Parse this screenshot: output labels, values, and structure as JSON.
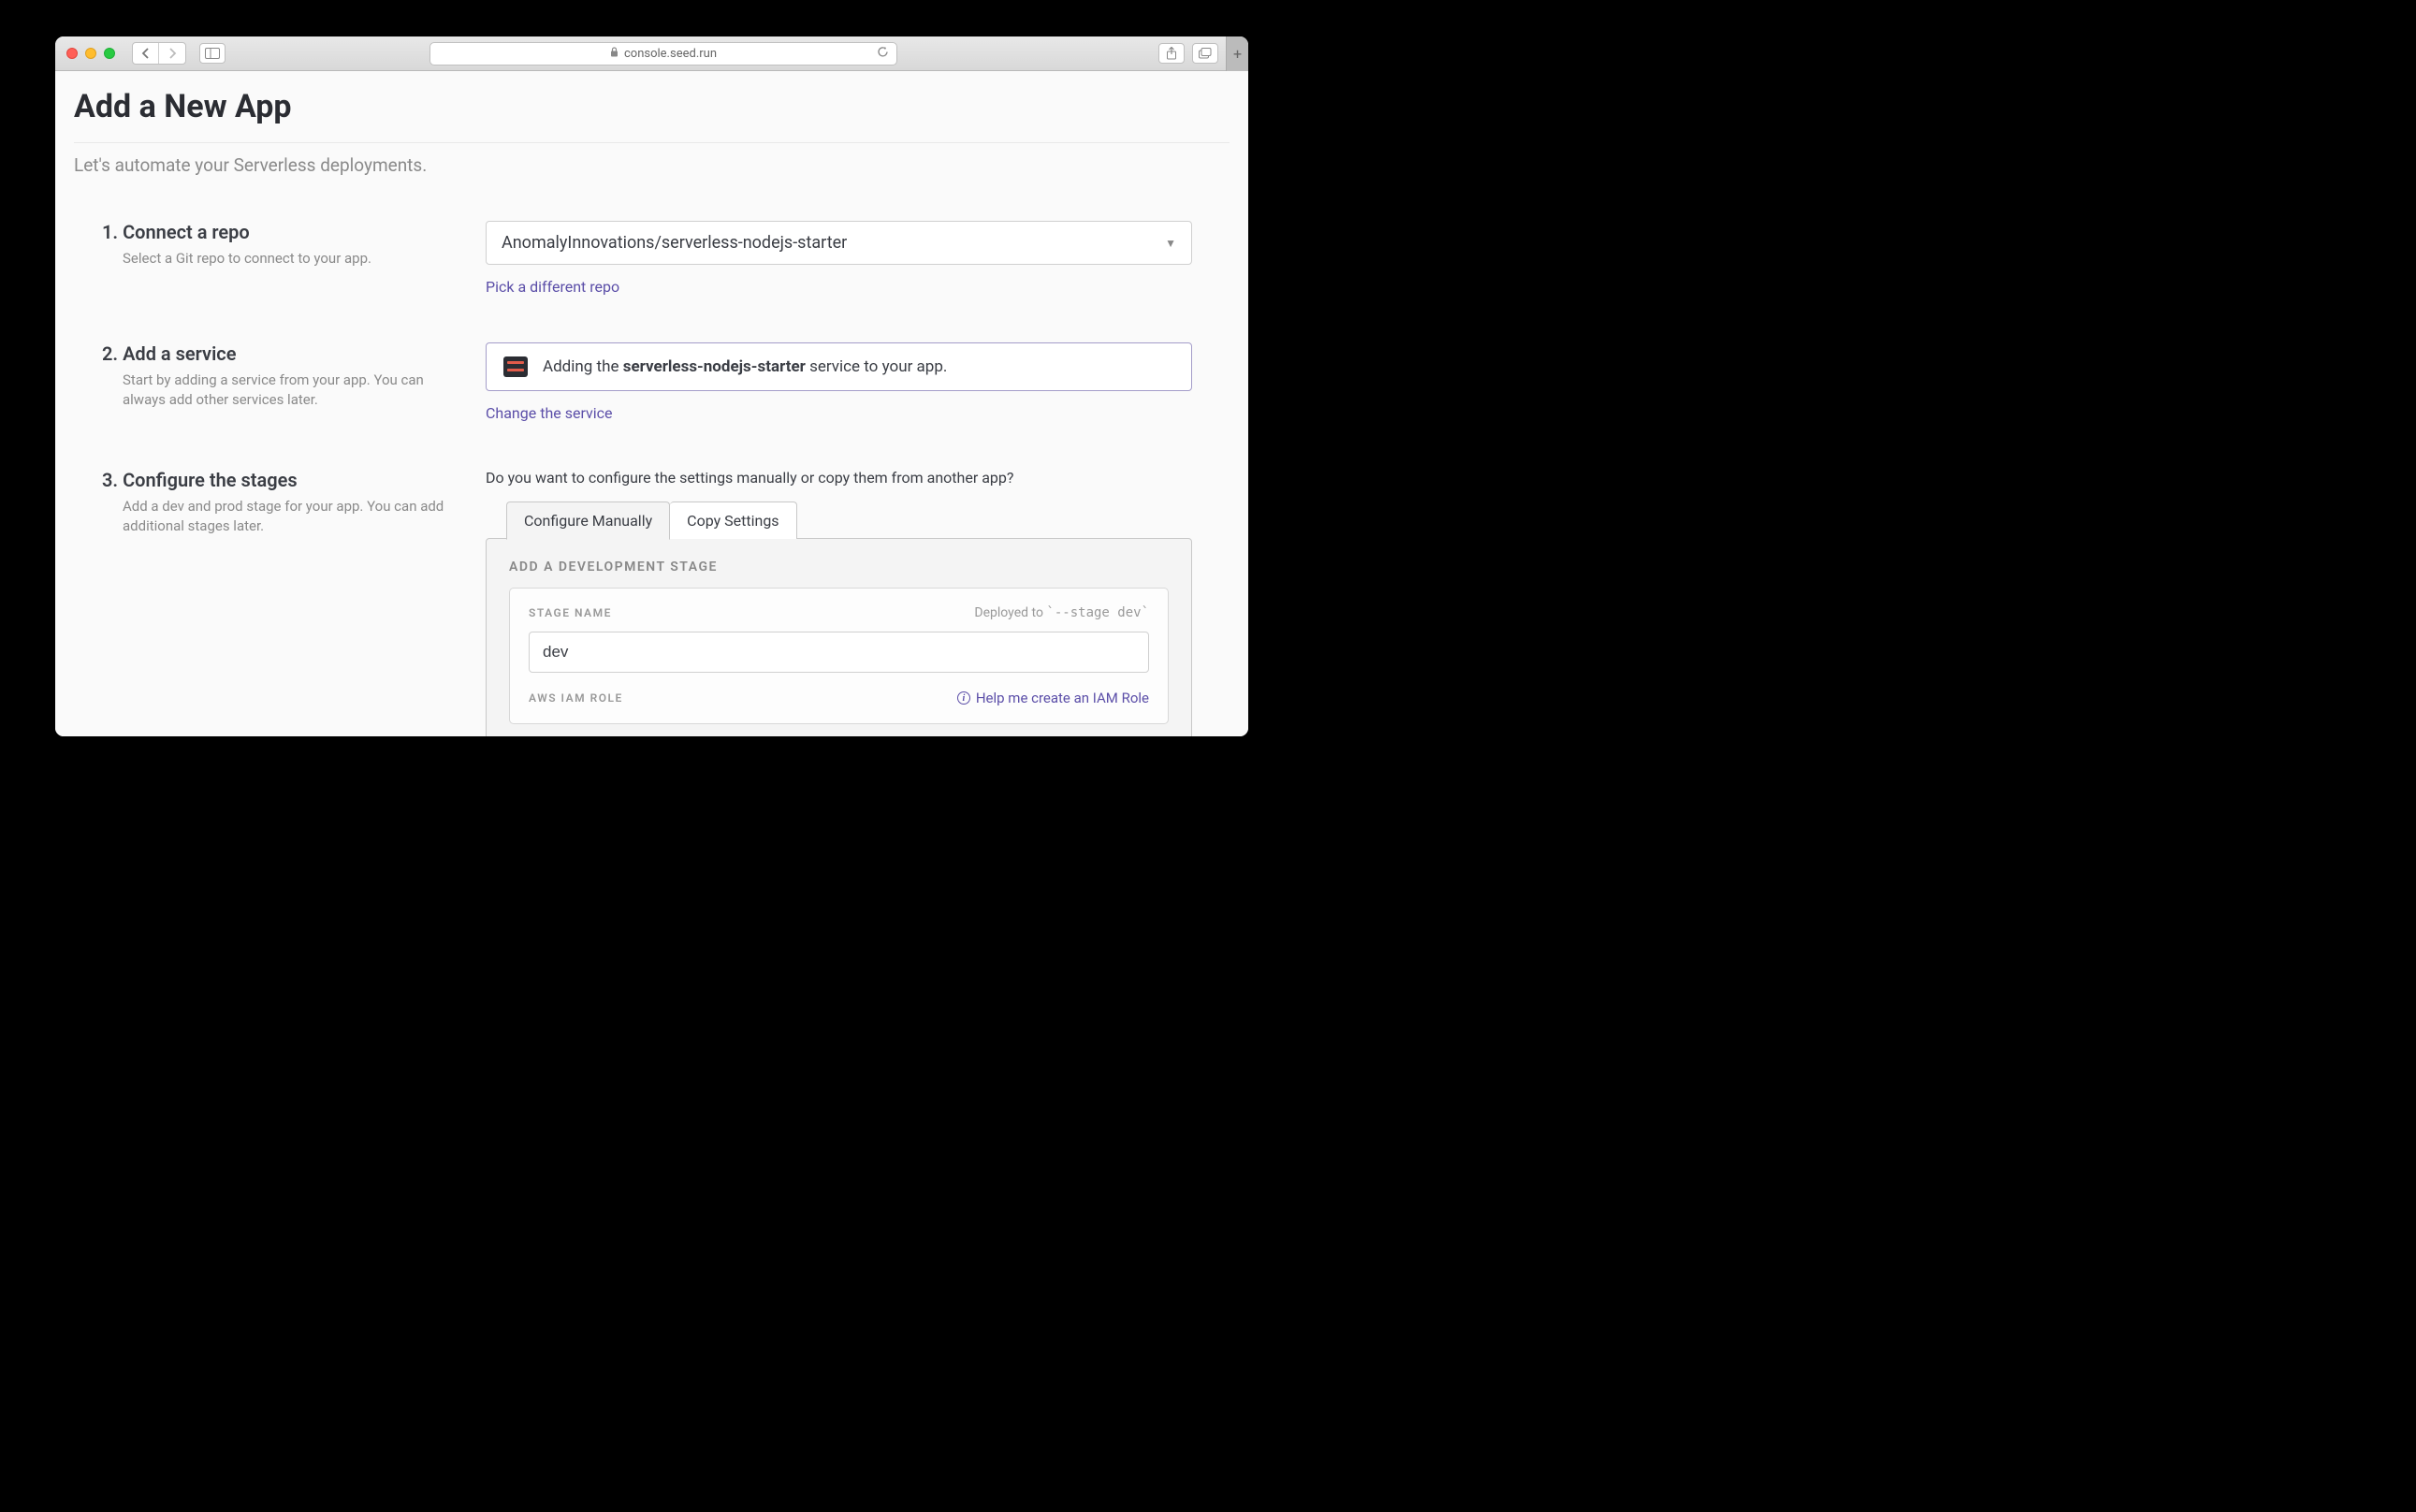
{
  "browser": {
    "url": "console.seed.run"
  },
  "page": {
    "title": "Add a New App",
    "subtitle": "Let's automate your Serverless deployments."
  },
  "steps": {
    "step1": {
      "title": "1. Connect a repo",
      "description": "Select a Git repo to connect to your app.",
      "selected_repo": "AnomalyInnovations/serverless-nodejs-starter",
      "change_link": "Pick a different repo"
    },
    "step2": {
      "title": "2. Add a service",
      "description": "Start by adding a service from your app. You can always add other services later.",
      "message_prefix": "Adding the ",
      "service_name": "serverless-nodejs-starter",
      "message_suffix": " service to your app.",
      "change_link": "Change the service"
    },
    "step3": {
      "title": "3. Configure the stages",
      "description": "Add a dev and prod stage for your app. You can add additional stages later.",
      "question": "Do you want to configure the settings manually or copy them from another app?",
      "tabs": {
        "manual": "Configure Manually",
        "copy": "Copy Settings"
      },
      "panel_heading": "ADD A DEVELOPMENT STAGE",
      "stage_name_label": "STAGE NAME",
      "deployed_to_prefix": "Deployed to ",
      "deployed_to_code": "`--stage dev`",
      "stage_name_value": "dev",
      "iam_label": "AWS IAM ROLE",
      "help_link": "Help me create an IAM Role"
    }
  }
}
